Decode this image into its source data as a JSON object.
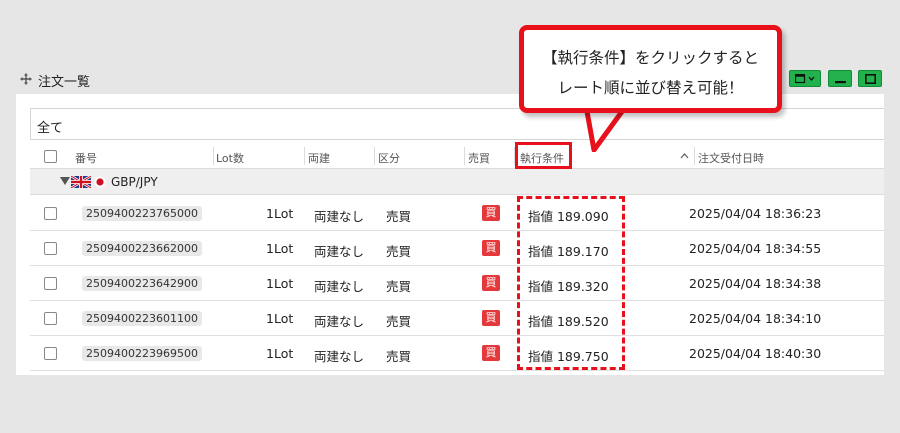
{
  "panel": {
    "title": "注文一覧"
  },
  "filter": {
    "value": "全て"
  },
  "columns": {
    "number": "番号",
    "lot": "Lot数",
    "ryodate": "両建",
    "kubun": "区分",
    "baibai": "売買",
    "condition": "執行条件",
    "received_time": "注文受付日時"
  },
  "group": {
    "label": "GBP/JPY"
  },
  "rows": [
    {
      "number": "2509400223765000",
      "lot": "1Lot",
      "ryodate": "両建なし",
      "kubun": "売買",
      "side": "買",
      "condition": "指値 189.090",
      "time": "2025/04/04 18:36:23"
    },
    {
      "number": "2509400223662000",
      "lot": "1Lot",
      "ryodate": "両建なし",
      "kubun": "売買",
      "side": "買",
      "condition": "指値 189.170",
      "time": "2025/04/04 18:34:55"
    },
    {
      "number": "2509400223642900",
      "lot": "1Lot",
      "ryodate": "両建なし",
      "kubun": "売買",
      "side": "買",
      "condition": "指値 189.320",
      "time": "2025/04/04 18:34:38"
    },
    {
      "number": "2509400223601100",
      "lot": "1Lot",
      "ryodate": "両建なし",
      "kubun": "売買",
      "side": "買",
      "condition": "指値 189.520",
      "time": "2025/04/04 18:34:10"
    },
    {
      "number": "2509400223969500",
      "lot": "1Lot",
      "ryodate": "両建なし",
      "kubun": "売買",
      "side": "買",
      "condition": "指値 189.750",
      "time": "2025/04/04 18:40:30"
    }
  ],
  "callout": {
    "line1": "【執行条件】をクリックすると",
    "line2": "レート順に並び替え可能！"
  },
  "colors": {
    "accent_red": "#e8101a",
    "window_button_green": "#22b14c",
    "buy_badge": "#e5383b"
  }
}
